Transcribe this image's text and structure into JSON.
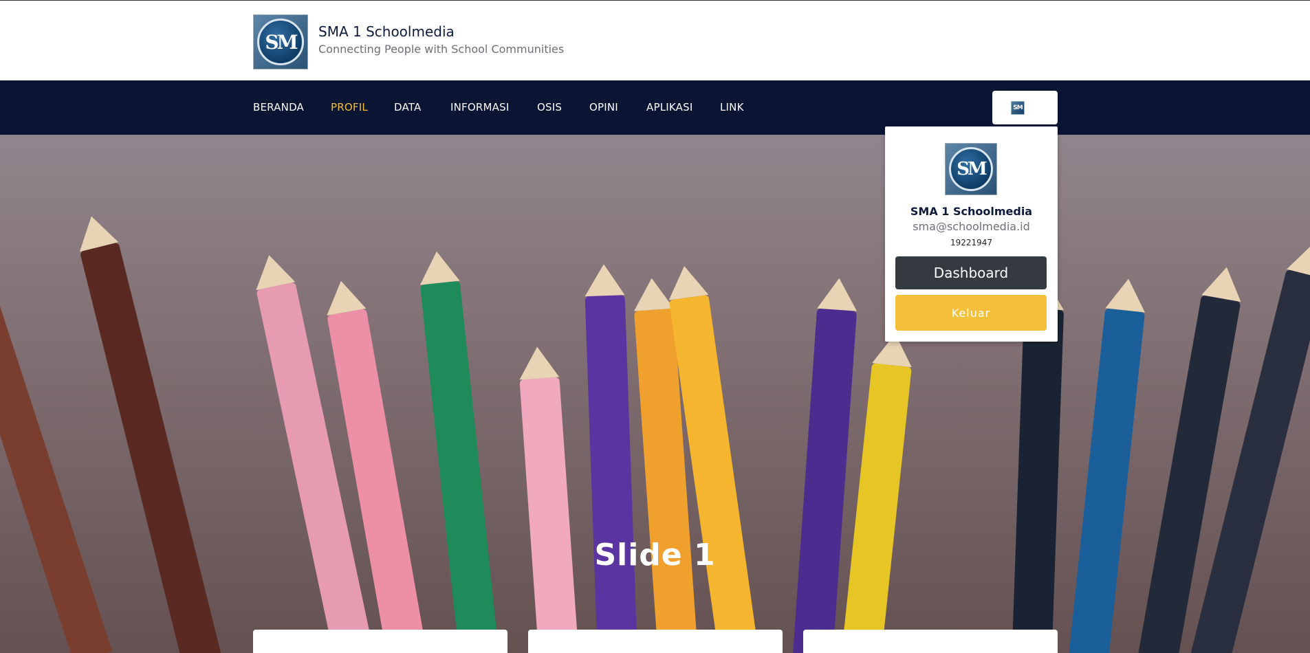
{
  "brand": {
    "title": "SMA 1 Schoolmedia",
    "subtitle": "Connecting People with School Communities",
    "logo_text": "SM"
  },
  "nav": {
    "items": [
      {
        "label": "BERANDA",
        "active": false
      },
      {
        "label": "PROFIL",
        "active": true
      },
      {
        "label": "DATA",
        "active": false
      },
      {
        "label": "INFORMASI",
        "active": false
      },
      {
        "label": "OSIS",
        "active": false
      },
      {
        "label": "OPINI",
        "active": false
      },
      {
        "label": "APLIKASI",
        "active": false
      },
      {
        "label": "LINK",
        "active": false
      }
    ],
    "active_color": "#f4c03a",
    "background": "#0a1433"
  },
  "user_menu": {
    "avatar_text": "SM",
    "name": "SMA 1 Schoolmedia",
    "email": "sma@schoolmedia.id",
    "id": "19221947",
    "dashboard_label": "Dashboard",
    "logout_label": "Keluar",
    "logout_color": "#f4c03a",
    "dashboard_color": "#343a40"
  },
  "hero": {
    "slide_title": "Slide 1"
  }
}
